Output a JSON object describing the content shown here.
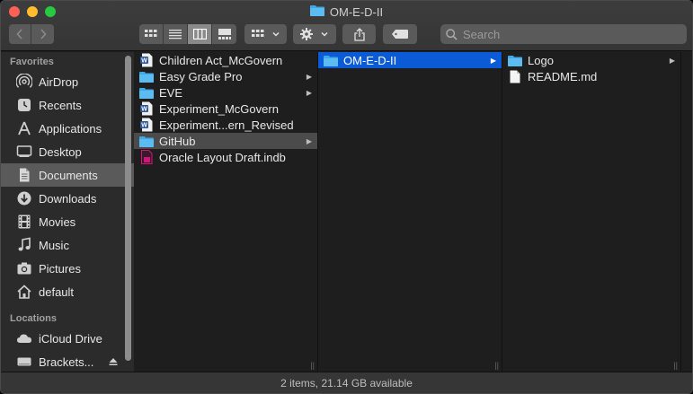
{
  "window": {
    "title": "OM-E-D-II"
  },
  "toolbar": {
    "back_icon": "chevron-left-icon",
    "forward_icon": "chevron-right-icon",
    "view_modes": [
      "icon-view",
      "list-view",
      "column-view",
      "gallery-view"
    ],
    "active_view": "column-view",
    "search_placeholder": "Search"
  },
  "sidebar": {
    "favorites_header": "Favorites",
    "favorites": [
      {
        "label": "AirDrop",
        "icon": "airdrop-icon"
      },
      {
        "label": "Recents",
        "icon": "clock-icon"
      },
      {
        "label": "Applications",
        "icon": "applications-icon"
      },
      {
        "label": "Desktop",
        "icon": "desktop-icon"
      },
      {
        "label": "Documents",
        "icon": "document-icon",
        "selected": true
      },
      {
        "label": "Downloads",
        "icon": "download-icon"
      },
      {
        "label": "Movies",
        "icon": "film-icon"
      },
      {
        "label": "Music",
        "icon": "music-icon"
      },
      {
        "label": "Pictures",
        "icon": "camera-icon"
      },
      {
        "label": "default",
        "icon": "home-icon"
      }
    ],
    "locations_header": "Locations",
    "locations": [
      {
        "label": "iCloud Drive",
        "icon": "cloud-icon"
      },
      {
        "label": "Brackets...",
        "icon": "disk-icon"
      }
    ]
  },
  "column1": [
    {
      "name": "Children Act_McGovern",
      "type": "word-doc"
    },
    {
      "name": "Easy Grade Pro",
      "type": "folder",
      "has_children": true
    },
    {
      "name": "EVE",
      "type": "folder",
      "has_children": true
    },
    {
      "name": "Experiment_McGovern",
      "type": "word-doc"
    },
    {
      "name": "Experiment...ern_Revised",
      "type": "word-doc"
    },
    {
      "name": "GitHub",
      "type": "folder",
      "has_children": true,
      "selected": true
    },
    {
      "name": "Oracle Layout Draft.indb",
      "type": "indesign-book"
    }
  ],
  "column2": [
    {
      "name": "OM-E-D-II",
      "type": "folder",
      "has_children": true,
      "selected": true
    }
  ],
  "column3": [
    {
      "name": "Logo",
      "type": "folder",
      "has_children": true
    },
    {
      "name": "README.md",
      "type": "file"
    }
  ],
  "status": {
    "text": "2 items, 21.14 GB available"
  },
  "colors": {
    "folder": "#3fa9e8",
    "selection": "#0b5bd7",
    "word": "#2b579a",
    "indesign": "#d4147a"
  }
}
